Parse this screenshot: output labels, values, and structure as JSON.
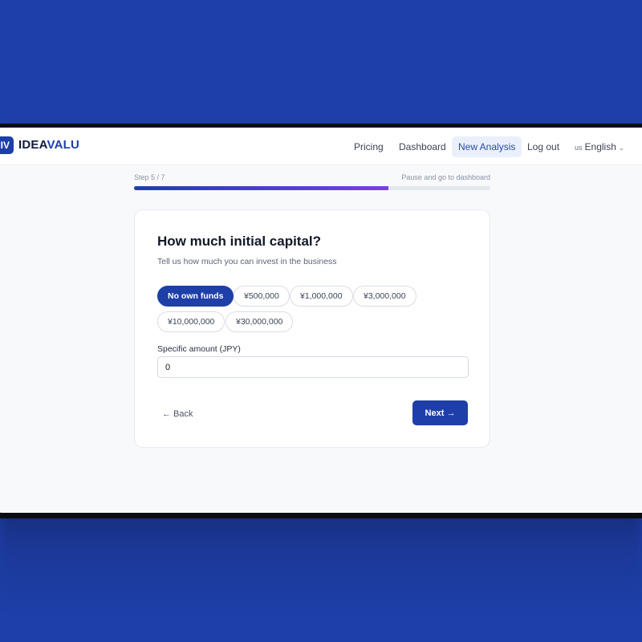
{
  "brand": {
    "mark": "IV",
    "name_part1": "IDEA",
    "name_part2": "VALU"
  },
  "nav": {
    "pricing": "Pricing",
    "dashboard": "Dashboard",
    "new_analysis": "New Analysis",
    "logout": "Log out",
    "language_flag": "us",
    "language": "English",
    "chevron_icon": "chevron-down-icon"
  },
  "progress": {
    "step_label": "Step 5 / 7",
    "pause_link": "Pause and go to dashboard",
    "fraction": 0.714
  },
  "question": {
    "title": "How much initial capital?",
    "subtitle": "Tell us how much you can invest in the business",
    "options": [
      "No own funds",
      "¥500,000",
      "¥1,000,000",
      "¥3,000,000",
      "¥10,000,000",
      "¥30,000,000"
    ],
    "selected_index": 0,
    "field_label": "Specific amount (JPY)",
    "field_value": "0"
  },
  "actions": {
    "back": "← Back",
    "next": "Next →"
  },
  "colors": {
    "background": "#1e3fa8",
    "accent": "#1e3fa8",
    "progress_end": "#7b3fe4"
  }
}
